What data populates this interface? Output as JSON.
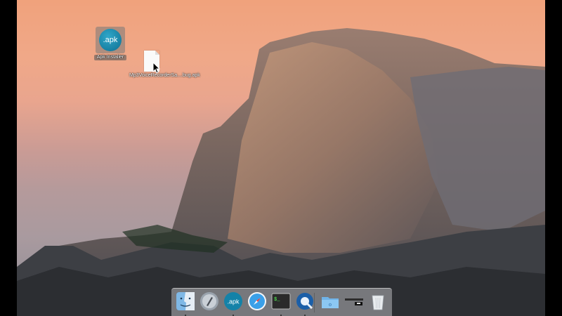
{
  "desktop": {
    "icons": [
      {
        "label": "Apk Installer",
        "glyph": ".apk"
      },
      {
        "label": "Mp3VoiceRecorderSa....bug.apk"
      }
    ]
  },
  "dock": {
    "items": [
      {
        "name": "finder-icon"
      },
      {
        "name": "launchpad-icon"
      },
      {
        "name": "apk-installer-icon",
        "glyph": ".apk"
      },
      {
        "name": "safari-icon"
      },
      {
        "name": "terminal-icon",
        "glyph": "$_"
      },
      {
        "name": "quicktime-icon"
      },
      {
        "name": "folder-icon"
      },
      {
        "name": "minimized-window-icon"
      },
      {
        "name": "trash-icon"
      }
    ]
  }
}
